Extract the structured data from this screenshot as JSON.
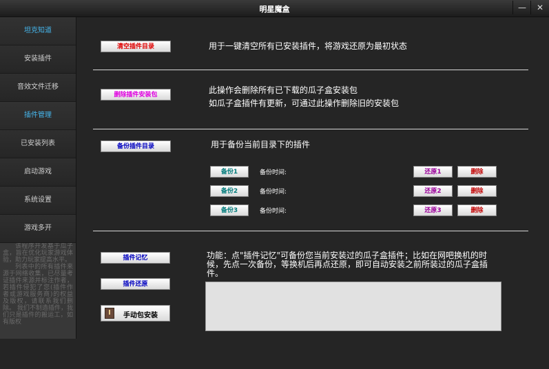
{
  "window": {
    "title": "明星魔盒",
    "minimize_glyph": "—",
    "close_glyph": "✕"
  },
  "sidebar": {
    "items": [
      {
        "label": "坦克知道",
        "active": true
      },
      {
        "label": "安装插件",
        "active": false
      },
      {
        "label": "音效文件迁移",
        "active": false
      },
      {
        "label": "插件管理",
        "active": true
      },
      {
        "label": "已安装列表",
        "active": false
      },
      {
        "label": "启动游戏",
        "active": false
      },
      {
        "label": "系统设置",
        "active": false
      },
      {
        "label": "游戏多开",
        "active": false
      }
    ],
    "notice": [
      "该程序开发基于瓜子盒，旨在优化玩家游戏体验，助力玩家提高水平。",
      "列表中的所有插件来源于网络收集，已尽量考证插件来源并标注作者，若插件侵犯了您(插件作者或游戏服务商)的权益及版权，请联系我们删除。 我们不制造插件，我们只是插件的搬运工，如有版权"
    ]
  },
  "main": {
    "clear_button": "清空插件目录",
    "clear_desc": "用于一键清空所有已安装插件，将游戏还原为最初状态",
    "delete_pkg_button": "删除插件安装包",
    "delete_pkg_desc_1": "此操作会删除所有已下载的瓜子盒安装包",
    "delete_pkg_desc_2": "如瓜子盒插件有更新，可通过此操作删除旧的安装包",
    "backup_dir_button": "备份插件目录",
    "backup_dir_desc": "用于备份当前目录下的插件",
    "backups": [
      {
        "backup_label": "备份1",
        "time_label": "备份时间:",
        "restore_label": "还原1",
        "delete_label": "删除"
      },
      {
        "backup_label": "备份2",
        "time_label": "备份时间:",
        "restore_label": "还原2",
        "delete_label": "删除"
      },
      {
        "backup_label": "备份3",
        "time_label": "备份时间:",
        "restore_label": "还原3",
        "delete_label": "删除"
      }
    ],
    "memory_button": "插件记忆",
    "restore_button": "插件还原",
    "manual_install_button": "手动包安装",
    "memory_desc": "功能：点\"插件记忆\"可备份您当前安装过的瓜子盒插件；比如在网吧换机的时候，先点一次备份，等换机后再点还原，即可自动安装之前所装过的瓜子盒插件。",
    "log_text": ""
  },
  "colors": {
    "accent": "#46b6ec",
    "background": "#252525",
    "sidebar": "#2b2b2b"
  }
}
